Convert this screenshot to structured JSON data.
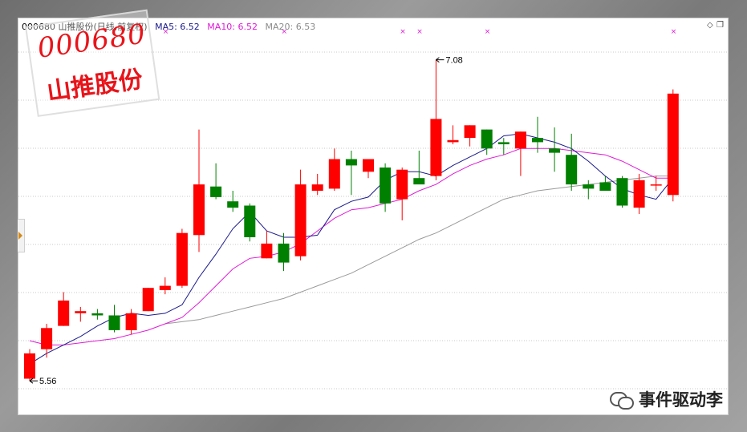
{
  "header": {
    "code_name": "000680 山推股份(日线,前复权)",
    "ma5": "MA5: 6.52",
    "ma10": "MA10: 6.52",
    "ma20": "MA20: 6.53"
  },
  "stamp": {
    "code": "000680",
    "name": "山推股份"
  },
  "watermark": {
    "text": "事件驱动李"
  },
  "controls": {
    "diamond": "◇",
    "restore": "❐"
  },
  "colors": {
    "up": "#ff0000",
    "down": "#008000",
    "ma5": "#1a1a8c",
    "ma10": "#e01ad8",
    "ma20": "#9a9a9a",
    "grid": "#c8c8c8"
  },
  "chart_data": {
    "type": "candlestick",
    "grid": "dotted horizontal",
    "ylim": [
      5.5,
      7.2
    ],
    "annotations": [
      {
        "label": "7.08",
        "value": 7.08,
        "candle_index": 24
      },
      {
        "label": "5.56",
        "value": 5.56,
        "candle_index": 0
      }
    ],
    "markers": {
      "symbol": "×",
      "candle_indices": [
        8,
        15,
        22,
        23,
        27,
        38
      ]
    },
    "candles": [
      {
        "o": 5.57,
        "h": 5.71,
        "l": 5.56,
        "c": 5.69
      },
      {
        "o": 5.71,
        "h": 5.83,
        "l": 5.67,
        "c": 5.81
      },
      {
        "o": 5.82,
        "h": 5.98,
        "l": 5.82,
        "c": 5.94
      },
      {
        "o": 5.88,
        "h": 5.91,
        "l": 5.84,
        "c": 5.89
      },
      {
        "o": 5.88,
        "h": 5.9,
        "l": 5.85,
        "c": 5.87
      },
      {
        "o": 5.87,
        "h": 5.92,
        "l": 5.79,
        "c": 5.8
      },
      {
        "o": 5.8,
        "h": 5.9,
        "l": 5.78,
        "c": 5.88
      },
      {
        "o": 5.89,
        "h": 6.0,
        "l": 5.89,
        "c": 6.0
      },
      {
        "o": 5.99,
        "h": 6.05,
        "l": 5.97,
        "c": 6.01
      },
      {
        "o": 6.01,
        "h": 6.28,
        "l": 6.0,
        "c": 6.26
      },
      {
        "o": 6.25,
        "h": 6.75,
        "l": 6.17,
        "c": 6.49
      },
      {
        "o": 6.48,
        "h": 6.59,
        "l": 6.42,
        "c": 6.43
      },
      {
        "o": 6.41,
        "h": 6.46,
        "l": 6.36,
        "c": 6.38
      },
      {
        "o": 6.39,
        "h": 6.4,
        "l": 6.22,
        "c": 6.24
      },
      {
        "o": 6.14,
        "h": 6.27,
        "l": 6.14,
        "c": 6.21
      },
      {
        "o": 6.21,
        "h": 6.26,
        "l": 6.08,
        "c": 6.12
      },
      {
        "o": 6.15,
        "h": 6.56,
        "l": 6.13,
        "c": 6.49
      },
      {
        "o": 6.46,
        "h": 6.54,
        "l": 6.44,
        "c": 6.49
      },
      {
        "o": 6.47,
        "h": 6.66,
        "l": 6.46,
        "c": 6.61
      },
      {
        "o": 6.61,
        "h": 6.65,
        "l": 6.44,
        "c": 6.58
      },
      {
        "o": 6.55,
        "h": 6.61,
        "l": 6.52,
        "c": 6.61
      },
      {
        "o": 6.57,
        "h": 6.59,
        "l": 6.36,
        "c": 6.4
      },
      {
        "o": 6.42,
        "h": 6.57,
        "l": 6.32,
        "c": 6.56
      },
      {
        "o": 6.52,
        "h": 6.65,
        "l": 6.5,
        "c": 6.49
      },
      {
        "o": 6.53,
        "h": 7.08,
        "l": 6.51,
        "c": 6.8
      },
      {
        "o": 6.69,
        "h": 6.77,
        "l": 6.68,
        "c": 6.7
      },
      {
        "o": 6.71,
        "h": 6.77,
        "l": 6.67,
        "c": 6.77
      },
      {
        "o": 6.75,
        "h": 6.75,
        "l": 6.63,
        "c": 6.66
      },
      {
        "o": 6.69,
        "h": 6.71,
        "l": 6.63,
        "c": 6.68
      },
      {
        "o": 6.66,
        "h": 6.74,
        "l": 6.53,
        "c": 6.74
      },
      {
        "o": 6.71,
        "h": 6.81,
        "l": 6.64,
        "c": 6.69
      },
      {
        "o": 6.66,
        "h": 6.76,
        "l": 6.55,
        "c": 6.64
      },
      {
        "o": 6.63,
        "h": 6.73,
        "l": 6.46,
        "c": 6.49
      },
      {
        "o": 6.49,
        "h": 6.51,
        "l": 6.42,
        "c": 6.47
      },
      {
        "o": 6.5,
        "h": 6.53,
        "l": 6.46,
        "c": 6.46
      },
      {
        "o": 6.52,
        "h": 6.53,
        "l": 6.38,
        "c": 6.39
      },
      {
        "o": 6.38,
        "h": 6.54,
        "l": 6.35,
        "c": 6.51
      },
      {
        "o": 6.49,
        "h": 6.53,
        "l": 6.46,
        "c": 6.49
      },
      {
        "o": 6.44,
        "h": 6.94,
        "l": 6.41,
        "c": 6.92
      }
    ],
    "ma5": [
      5.64,
      5.69,
      5.73,
      5.77,
      5.82,
      5.86,
      5.88,
      5.87,
      5.88,
      5.92,
      6.05,
      6.16,
      6.28,
      6.36,
      6.27,
      6.24,
      6.24,
      6.25,
      6.37,
      6.41,
      6.43,
      6.51,
      6.55,
      6.55,
      6.53,
      6.58,
      6.62,
      6.66,
      6.72,
      6.73,
      6.71,
      6.69,
      6.66,
      6.6,
      6.53,
      6.47,
      6.44,
      6.42,
      6.52
    ],
    "ma10": [
      5.75,
      5.73,
      5.73,
      5.74,
      5.75,
      5.76,
      5.78,
      5.8,
      5.83,
      5.86,
      5.93,
      6.01,
      6.09,
      6.14,
      6.15,
      6.17,
      6.21,
      6.27,
      6.33,
      6.37,
      6.38,
      6.4,
      6.42,
      6.46,
      6.49,
      6.54,
      6.58,
      6.61,
      6.63,
      6.66,
      6.66,
      6.66,
      6.65,
      6.64,
      6.63,
      6.6,
      6.56,
      6.52,
      6.52
    ],
    "ma20": [
      null,
      null,
      null,
      null,
      null,
      null,
      null,
      null,
      5.83,
      5.84,
      5.85,
      5.87,
      5.89,
      5.91,
      5.93,
      5.95,
      5.98,
      6.01,
      6.04,
      6.07,
      6.11,
      6.15,
      6.19,
      6.23,
      6.26,
      6.3,
      6.34,
      6.38,
      6.42,
      6.44,
      6.46,
      6.47,
      6.48,
      6.49,
      6.5,
      6.51,
      6.52,
      6.53,
      6.53
    ]
  }
}
